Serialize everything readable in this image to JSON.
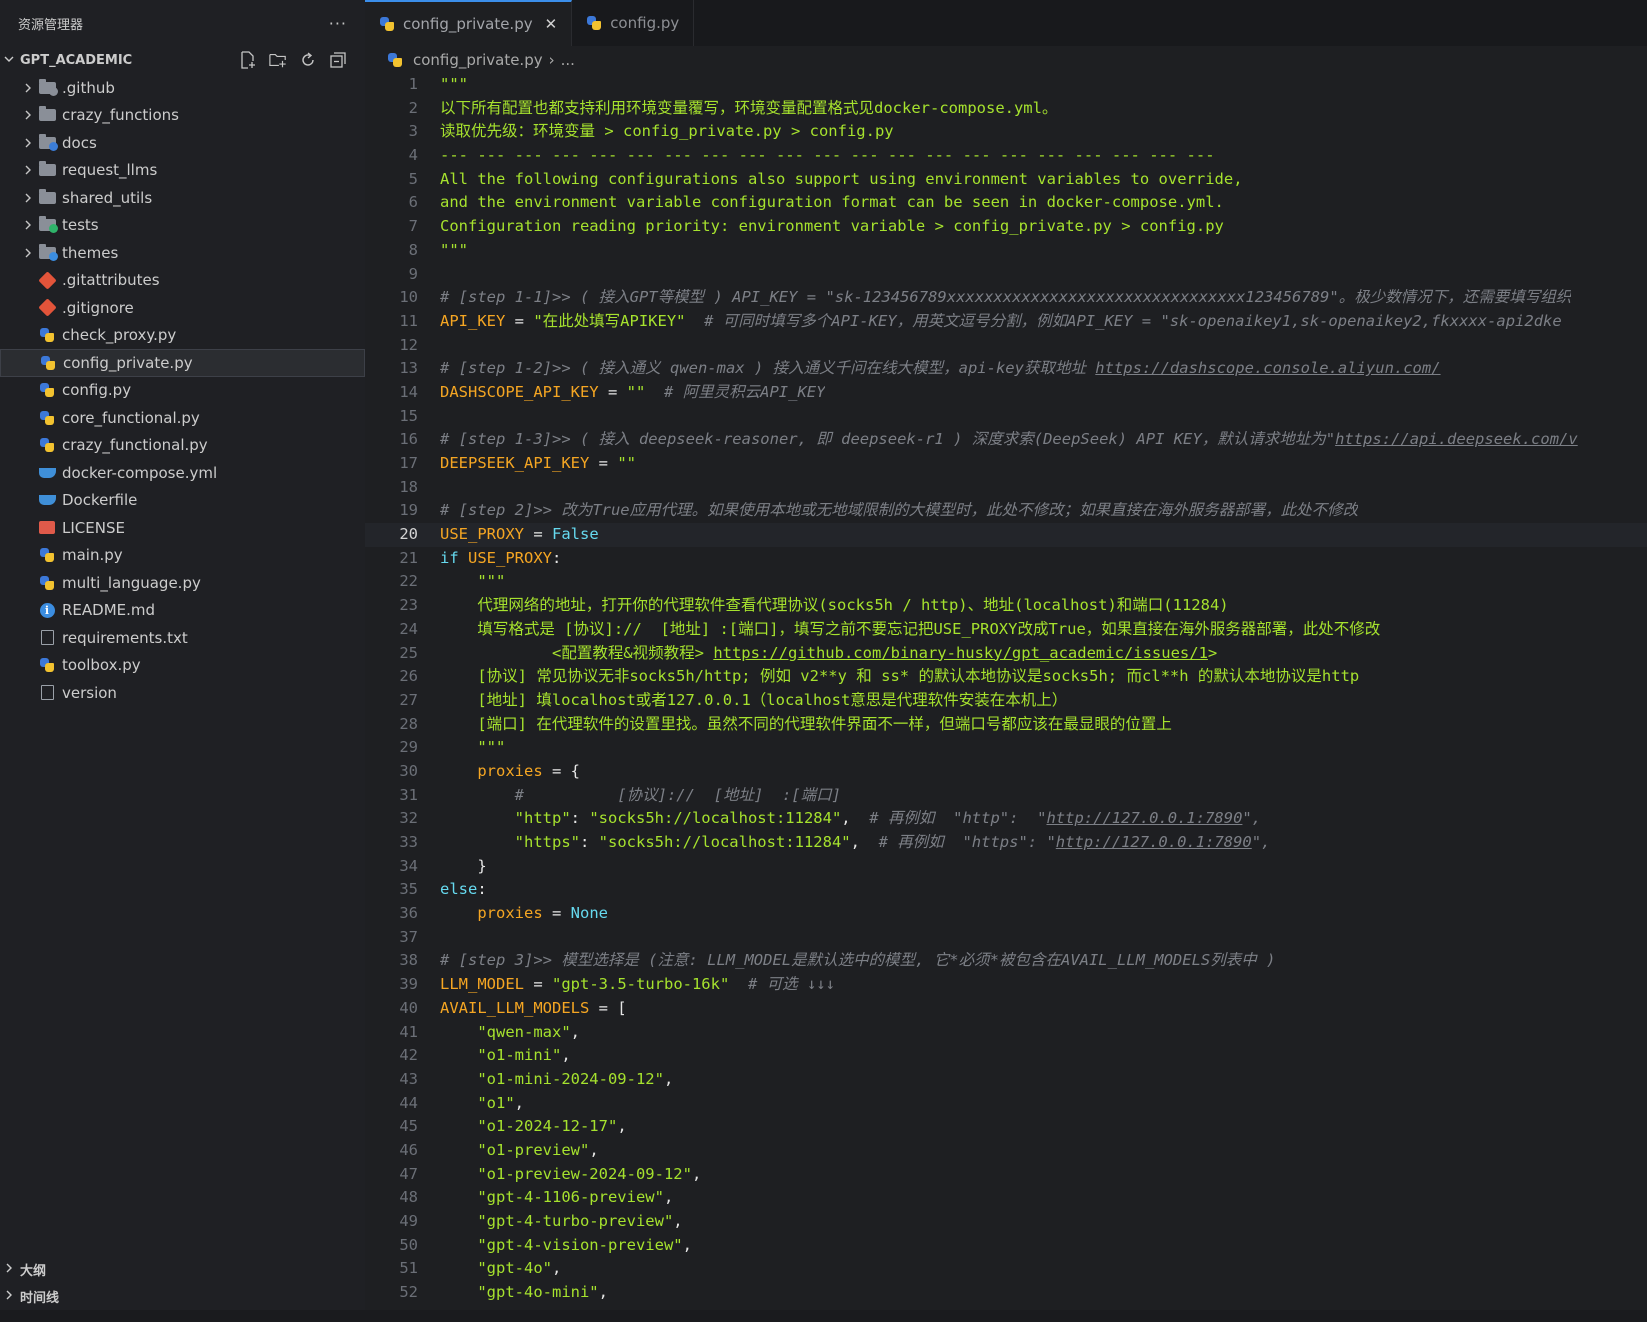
{
  "sidebar": {
    "title": "资源管理器",
    "more_label": "···",
    "workspace": "GPT_ACADEMIC",
    "items": [
      {
        "label": ".github",
        "type": "folder",
        "badge": "#8a8f98"
      },
      {
        "label": "crazy_functions",
        "type": "folder",
        "badge": ""
      },
      {
        "label": "docs",
        "type": "folder",
        "badge": "#3b7dd8"
      },
      {
        "label": "request_llms",
        "type": "folder",
        "badge": ""
      },
      {
        "label": "shared_utils",
        "type": "folder",
        "badge": ""
      },
      {
        "label": "tests",
        "type": "folder",
        "badge": "#2fb36a"
      },
      {
        "label": "themes",
        "type": "folder",
        "badge": "#3b8de0"
      },
      {
        "label": ".gitattributes",
        "type": "git"
      },
      {
        "label": ".gitignore",
        "type": "git"
      },
      {
        "label": "check_proxy.py",
        "type": "py"
      },
      {
        "label": "config_private.py",
        "type": "py",
        "active": true
      },
      {
        "label": "config.py",
        "type": "py"
      },
      {
        "label": "core_functional.py",
        "type": "py"
      },
      {
        "label": "crazy_functional.py",
        "type": "py"
      },
      {
        "label": "docker-compose.yml",
        "type": "docker"
      },
      {
        "label": "Dockerfile",
        "type": "docker"
      },
      {
        "label": "LICENSE",
        "type": "license"
      },
      {
        "label": "main.py",
        "type": "py"
      },
      {
        "label": "multi_language.py",
        "type": "py"
      },
      {
        "label": "README.md",
        "type": "info"
      },
      {
        "label": "requirements.txt",
        "type": "txt"
      },
      {
        "label": "toolbox.py",
        "type": "py"
      },
      {
        "label": "version",
        "type": "txt"
      }
    ],
    "outline_label": "大纲",
    "timeline_label": "时间线"
  },
  "tabs": [
    {
      "label": "config_private.py",
      "active": true
    },
    {
      "label": "config.py",
      "active": false
    }
  ],
  "breadcrumb": {
    "file": "config_private.py",
    "rest": "..."
  },
  "current_line": 20,
  "colors": {
    "accent": "#3b8eea",
    "string": "#a6e22e",
    "comment": "#7c7f86",
    "variable": "#f5a623",
    "keyword": "#66d9ef"
  },
  "code_lines": [
    [
      [
        "str",
        "\"\"\""
      ]
    ],
    [
      [
        "str",
        "以下所有配置也都支持利用环境变量覆写，环境变量配置格式见docker-compose.yml。"
      ]
    ],
    [
      [
        "str",
        "读取优先级：环境变量 > config_private.py > config.py"
      ]
    ],
    [
      [
        "str",
        "--- --- --- --- --- --- --- --- --- --- --- --- --- --- --- --- --- --- --- --- ---"
      ]
    ],
    [
      [
        "str",
        "All the following configurations also support using environment variables to override,"
      ]
    ],
    [
      [
        "str",
        "and the environment variable configuration format can be seen in docker-compose.yml."
      ]
    ],
    [
      [
        "str",
        "Configuration reading priority: environment variable > config_private.py > config.py"
      ]
    ],
    [
      [
        "str",
        "\"\"\""
      ]
    ],
    [],
    [
      [
        "cmt",
        "# [step 1-1]>> ( 接入GPT等模型 ) API_KEY = \"sk-123456789xxxxxxxxxxxxxxxxxxxxxxxxxxxxxxxx123456789\"。极少数情况下，还需要填写组织"
      ]
    ],
    [
      [
        "var",
        "API_KEY"
      ],
      [
        "op",
        " = "
      ],
      [
        "str",
        "\"在此处填写APIKEY\""
      ],
      [
        "cmt",
        "  # 可同时填写多个API-KEY，用英文逗号分割，例如API_KEY = \"sk-openaikey1,sk-openaikey2,fkxxxx-api2dke"
      ]
    ],
    [],
    [
      [
        "cmt",
        "# [step 1-2]>> ( 接入通义 qwen-max ) 接入通义千问在线大模型，api-key获取地址 "
      ],
      [
        "cmturl",
        "https://dashscope.console.aliyun.com/"
      ]
    ],
    [
      [
        "var",
        "DASHSCOPE_API_KEY"
      ],
      [
        "op",
        " = "
      ],
      [
        "str",
        "\"\""
      ],
      [
        "cmt",
        "  # 阿里灵积云API_KEY"
      ]
    ],
    [],
    [
      [
        "cmt",
        "# [step 1-3]>> ( 接入 deepseek-reasoner, 即 deepseek-r1 ) 深度求索(DeepSeek) API KEY，默认请求地址为\""
      ],
      [
        "cmturl",
        "https://api.deepseek.com/v"
      ]
    ],
    [
      [
        "var",
        "DEEPSEEK_API_KEY"
      ],
      [
        "op",
        " = "
      ],
      [
        "str",
        "\"\""
      ]
    ],
    [],
    [
      [
        "cmt",
        "# [step 2]>> 改为True应用代理。如果使用本地或无地域限制的大模型时，此处不修改；如果直接在海外服务器部署，此处不修改"
      ]
    ],
    [
      [
        "var",
        "USE_PROXY"
      ],
      [
        "op",
        " = "
      ],
      [
        "kw",
        "False"
      ]
    ],
    [
      [
        "kw",
        "if "
      ],
      [
        "var",
        "USE_PROXY"
      ],
      [
        "op",
        ":"
      ]
    ],
    [
      [
        "op",
        "    "
      ],
      [
        "str",
        "\"\"\""
      ]
    ],
    [
      [
        "op",
        "    "
      ],
      [
        "str",
        "代理网络的地址，打开你的代理软件查看代理协议(socks5h / http)、地址(localhost)和端口(11284)"
      ]
    ],
    [
      [
        "op",
        "    "
      ],
      [
        "str",
        "填写格式是 [协议]://  [地址] :[端口]，填写之前不要忘记把USE_PROXY改成True，如果直接在海外服务器部署，此处不修改"
      ]
    ],
    [
      [
        "op",
        "            "
      ],
      [
        "str",
        "<配置教程&视频教程> "
      ],
      [
        "strurl",
        "https://github.com/binary-husky/gpt_academic/issues/1"
      ],
      [
        "str",
        ">"
      ]
    ],
    [
      [
        "op",
        "    "
      ],
      [
        "str",
        "[协议] 常见协议无非socks5h/http; 例如 v2**y 和 ss* 的默认本地协议是socks5h; 而cl**h 的默认本地协议是http"
      ]
    ],
    [
      [
        "op",
        "    "
      ],
      [
        "str",
        "[地址] 填localhost或者127.0.0.1（localhost意思是代理软件安装在本机上）"
      ]
    ],
    [
      [
        "op",
        "    "
      ],
      [
        "str",
        "[端口] 在代理软件的设置里找。虽然不同的代理软件界面不一样，但端口号都应该在最显眼的位置上"
      ]
    ],
    [
      [
        "op",
        "    "
      ],
      [
        "str",
        "\"\"\""
      ]
    ],
    [
      [
        "op",
        "    "
      ],
      [
        "var",
        "proxies"
      ],
      [
        "op",
        " = {"
      ]
    ],
    [
      [
        "op",
        "        "
      ],
      [
        "cmt",
        "#          [协议]://  [地址]  :[端口]"
      ]
    ],
    [
      [
        "op",
        "        "
      ],
      [
        "str",
        "\"http\""
      ],
      [
        "op",
        ": "
      ],
      [
        "str",
        "\"socks5h://localhost:11284\""
      ],
      [
        "op",
        ",  "
      ],
      [
        "cmt",
        "# 再例如  \"http\":  \""
      ],
      [
        "cmturl",
        "http://127.0.0.1:7890"
      ],
      [
        "cmt",
        "\","
      ]
    ],
    [
      [
        "op",
        "        "
      ],
      [
        "str",
        "\"https\""
      ],
      [
        "op",
        ": "
      ],
      [
        "str",
        "\"socks5h://localhost:11284\""
      ],
      [
        "op",
        ",  "
      ],
      [
        "cmt",
        "# 再例如  \"https\": \""
      ],
      [
        "cmturl",
        "http://127.0.0.1:7890"
      ],
      [
        "cmt",
        "\","
      ]
    ],
    [
      [
        "op",
        "    }"
      ]
    ],
    [
      [
        "kw",
        "else"
      ],
      [
        "op",
        ":"
      ]
    ],
    [
      [
        "op",
        "    "
      ],
      [
        "var",
        "proxies"
      ],
      [
        "op",
        " = "
      ],
      [
        "kw",
        "None"
      ]
    ],
    [],
    [
      [
        "cmt",
        "# [step 3]>> 模型选择是 (注意: LLM_MODEL是默认选中的模型, 它*必须*被包含在AVAIL_LLM_MODELS列表中 )"
      ]
    ],
    [
      [
        "var",
        "LLM_MODEL"
      ],
      [
        "op",
        " = "
      ],
      [
        "str",
        "\"gpt-3.5-turbo-16k\""
      ],
      [
        "cmt",
        "  # 可选 ↓↓↓"
      ]
    ],
    [
      [
        "var",
        "AVAIL_LLM_MODELS"
      ],
      [
        "op",
        " = ["
      ]
    ],
    [
      [
        "op",
        "    "
      ],
      [
        "str",
        "\"qwen-max\""
      ],
      [
        "op",
        ","
      ]
    ],
    [
      [
        "op",
        "    "
      ],
      [
        "str",
        "\"o1-mini\""
      ],
      [
        "op",
        ","
      ]
    ],
    [
      [
        "op",
        "    "
      ],
      [
        "str",
        "\"o1-mini-2024-09-12\""
      ],
      [
        "op",
        ","
      ]
    ],
    [
      [
        "op",
        "    "
      ],
      [
        "str",
        "\"o1\""
      ],
      [
        "op",
        ","
      ]
    ],
    [
      [
        "op",
        "    "
      ],
      [
        "str",
        "\"o1-2024-12-17\""
      ],
      [
        "op",
        ","
      ]
    ],
    [
      [
        "op",
        "    "
      ],
      [
        "str",
        "\"o1-preview\""
      ],
      [
        "op",
        ","
      ]
    ],
    [
      [
        "op",
        "    "
      ],
      [
        "str",
        "\"o1-preview-2024-09-12\""
      ],
      [
        "op",
        ","
      ]
    ],
    [
      [
        "op",
        "    "
      ],
      [
        "str",
        "\"gpt-4-1106-preview\""
      ],
      [
        "op",
        ","
      ]
    ],
    [
      [
        "op",
        "    "
      ],
      [
        "str",
        "\"gpt-4-turbo-preview\""
      ],
      [
        "op",
        ","
      ]
    ],
    [
      [
        "op",
        "    "
      ],
      [
        "str",
        "\"gpt-4-vision-preview\""
      ],
      [
        "op",
        ","
      ]
    ],
    [
      [
        "op",
        "    "
      ],
      [
        "str",
        "\"gpt-4o\""
      ],
      [
        "op",
        ","
      ]
    ],
    [
      [
        "op",
        "    "
      ],
      [
        "str",
        "\"gpt-4o-mini\""
      ],
      [
        "op",
        ","
      ]
    ]
  ]
}
